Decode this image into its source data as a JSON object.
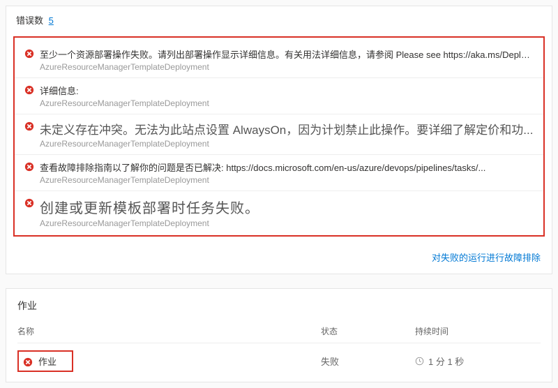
{
  "header": {
    "error_count_label": "错误数",
    "error_count": "5"
  },
  "errors": [
    {
      "title": "至少一个资源部署操作失败。请列出部署操作显示详细信息。有关用法详细信息，请参阅 Please see https://aka.ms/DeployOper...",
      "source": "AzureResourceManagerTemplateDeployment",
      "size": "sm"
    },
    {
      "title": "详细信息:",
      "source": "AzureResourceManagerTemplateDeployment",
      "size": "sm"
    },
    {
      "title": "未定义存在冲突。无法为此站点设置 AlwaysOn，因为计划禁止此操作。要详细了解定价和功...",
      "source": "AzureResourceManagerTemplateDeployment",
      "size": "lg"
    },
    {
      "title": "查看故障排除指南以了解你的问题是否已解决: https://docs.microsoft.com/en-us/azure/devops/pipelines/tasks/...",
      "source": "AzureResourceManagerTemplateDeployment",
      "size": "sm"
    },
    {
      "title": "创建或更新模板部署时任务失败。",
      "source": "AzureResourceManagerTemplateDeployment",
      "size": "xl"
    }
  ],
  "troubleshoot_link": "对失败的运行进行故障排除",
  "jobs": {
    "heading": "作业",
    "columns": {
      "name": "名称",
      "status": "状态",
      "duration": "持续时间"
    },
    "rows": [
      {
        "name": "作业",
        "status": "失败",
        "duration": "1 分 1 秒"
      }
    ]
  }
}
